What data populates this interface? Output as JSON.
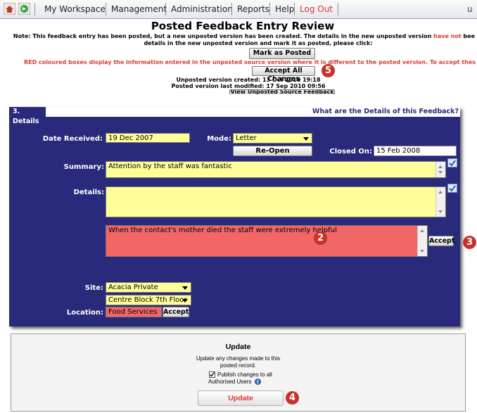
{
  "nav": {
    "items": [
      "My Workspace",
      "Management",
      "Administration",
      "Reports",
      "Help",
      "Log Out"
    ],
    "user_fragment": "u"
  },
  "review": {
    "title": "Posted Feedback Entry Review",
    "note_part1": "Note: This feedback entry has been posted, but a new unposted version has been created. The details in the new unposted version ",
    "note_highlight": "have not",
    "note_part2": " bee",
    "note_line2": "details in the new unposted version and mark it as posted, please click:",
    "mark_as_posted": "Mark as Posted",
    "red_note": "RED coloured boxes display the information entered in the unposted source version where it is different to the posted version. To accept thes",
    "accept_all": "Accept All Changes",
    "unposted_created": "Unposted version created: 13 Oct 2010 19:18",
    "posted_modified": "Posted version last modified: 17 Sep 2010 09:56",
    "view_unposted": "View Unposted Source Feedback"
  },
  "details": {
    "section_tab": "3. Details",
    "question": "What are the Details of this Feedback?",
    "date_received_label": "Date Received:",
    "date_received": "19 Dec 2007",
    "mode_label": "Mode:",
    "mode": "Letter",
    "reopen": "Re-Open",
    "closed_on_label": "Closed On:",
    "closed_on": "15 Feb 2008",
    "summary_label": "Summary:",
    "summary": "Attention by the staff was fantastic",
    "details_label": "Details:",
    "details_value": "",
    "unposted_details": "When the contact's mother died the staff were extremely helpful",
    "accept": "Accept",
    "site_label": "Site:",
    "site": "Acacia Private",
    "site_sub": "Centre Block 7th Floor",
    "location_label": "Location:",
    "location": "Food Services",
    "location_accept": "Accept"
  },
  "update": {
    "title": "Update",
    "desc_line1": "Update any changes made to this",
    "desc_line2": "posted record.",
    "publish_line1": "Publish changes to all",
    "publish_line2": "Authorised Users",
    "publish_checked": true,
    "button": "Update"
  },
  "callouts": [
    "2",
    "3",
    "4",
    "5"
  ],
  "colors": {
    "panel_blue": "#2a2a7c",
    "changed_red": "#f26666",
    "field_yellow": "#ffff9a",
    "callout_red": "#c8302a",
    "logout_red": "#d93a2b"
  }
}
